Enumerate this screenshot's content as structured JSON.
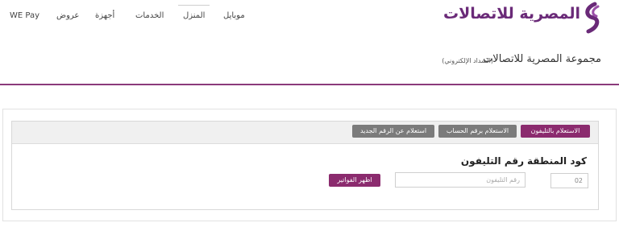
{
  "brand": {
    "logo_text": "المصرية للاتصالات",
    "accent_color": "#8b2b6e",
    "logo_color": "#6a2a78",
    "inactive_tab_color": "#7b7b7b"
  },
  "nav": {
    "items": [
      {
        "label": "موبايل"
      },
      {
        "label": "المنزل"
      },
      {
        "label": "الخدمات"
      },
      {
        "label": "أجهزة"
      },
      {
        "label": "عروض"
      },
      {
        "label": "WE Pay"
      }
    ]
  },
  "page": {
    "title": "مجموعة المصرية للاتصالات",
    "subtitle": "(السداد الإلكتروني)"
  },
  "tabs": [
    {
      "label": "الاستعلام بالتليفون",
      "active": true
    },
    {
      "label": "الاستعلام برقم الحساب",
      "active": false
    },
    {
      "label": "استعلام عن الرقم الجديد",
      "active": false
    }
  ],
  "form": {
    "area_code_label": "كود المنطقة",
    "area_code_value": "02",
    "phone_label": "رقم التليفون",
    "phone_placeholder": "رقم التليفون",
    "submit_label": "اظهر الفواتير"
  }
}
